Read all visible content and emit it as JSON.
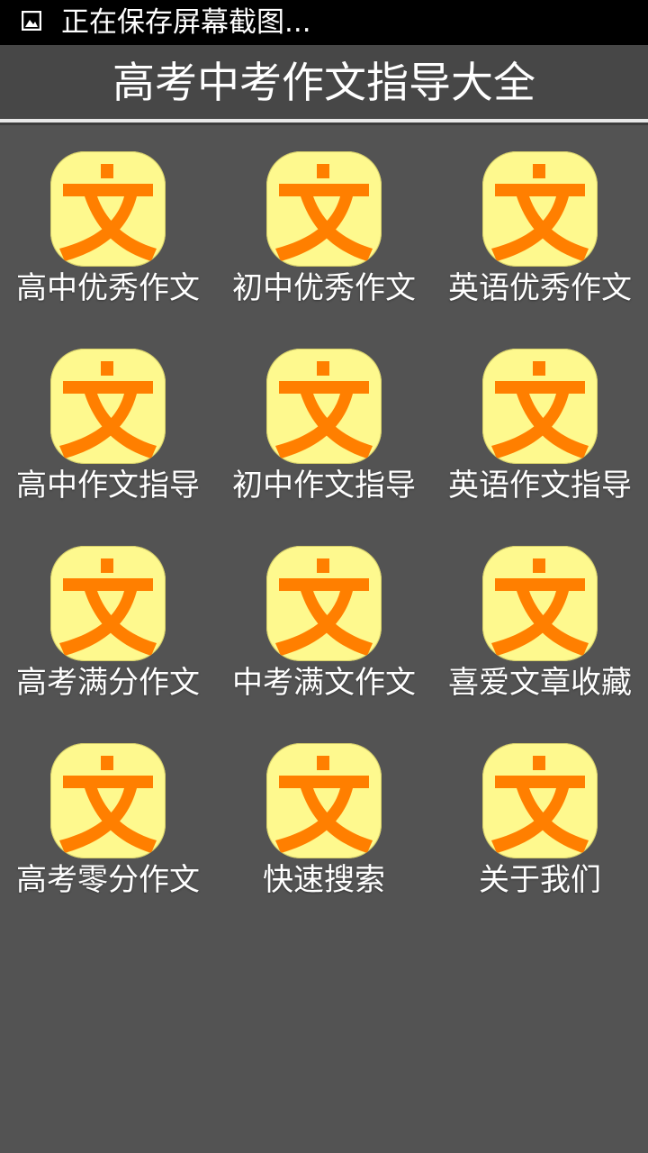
{
  "status_bar": {
    "text": "正在保存屏幕截图...",
    "icon": "image-icon"
  },
  "header": {
    "title": "高考中考作文指导大全"
  },
  "colors": {
    "background": "#535353",
    "status_bar": "#000000",
    "title_bar": "#474747",
    "icon_background": "#fef98e",
    "icon_glyph": "#ff7f00",
    "text": "#ffffff"
  },
  "menu": {
    "items": [
      {
        "label": "高中优秀作文",
        "icon": "wen-character-icon"
      },
      {
        "label": "初中优秀作文",
        "icon": "wen-character-icon"
      },
      {
        "label": "英语优秀作文",
        "icon": "wen-character-icon"
      },
      {
        "label": "高中作文指导",
        "icon": "wen-character-icon"
      },
      {
        "label": "初中作文指导",
        "icon": "wen-character-icon"
      },
      {
        "label": "英语作文指导",
        "icon": "wen-character-icon"
      },
      {
        "label": "高考满分作文",
        "icon": "wen-character-icon"
      },
      {
        "label": "中考满文作文",
        "icon": "wen-character-icon"
      },
      {
        "label": "喜爱文章收藏",
        "icon": "wen-character-icon"
      },
      {
        "label": "高考零分作文",
        "icon": "wen-character-icon"
      },
      {
        "label": "快速搜索",
        "icon": "wen-character-icon"
      },
      {
        "label": "关于我们",
        "icon": "wen-character-icon"
      }
    ]
  }
}
